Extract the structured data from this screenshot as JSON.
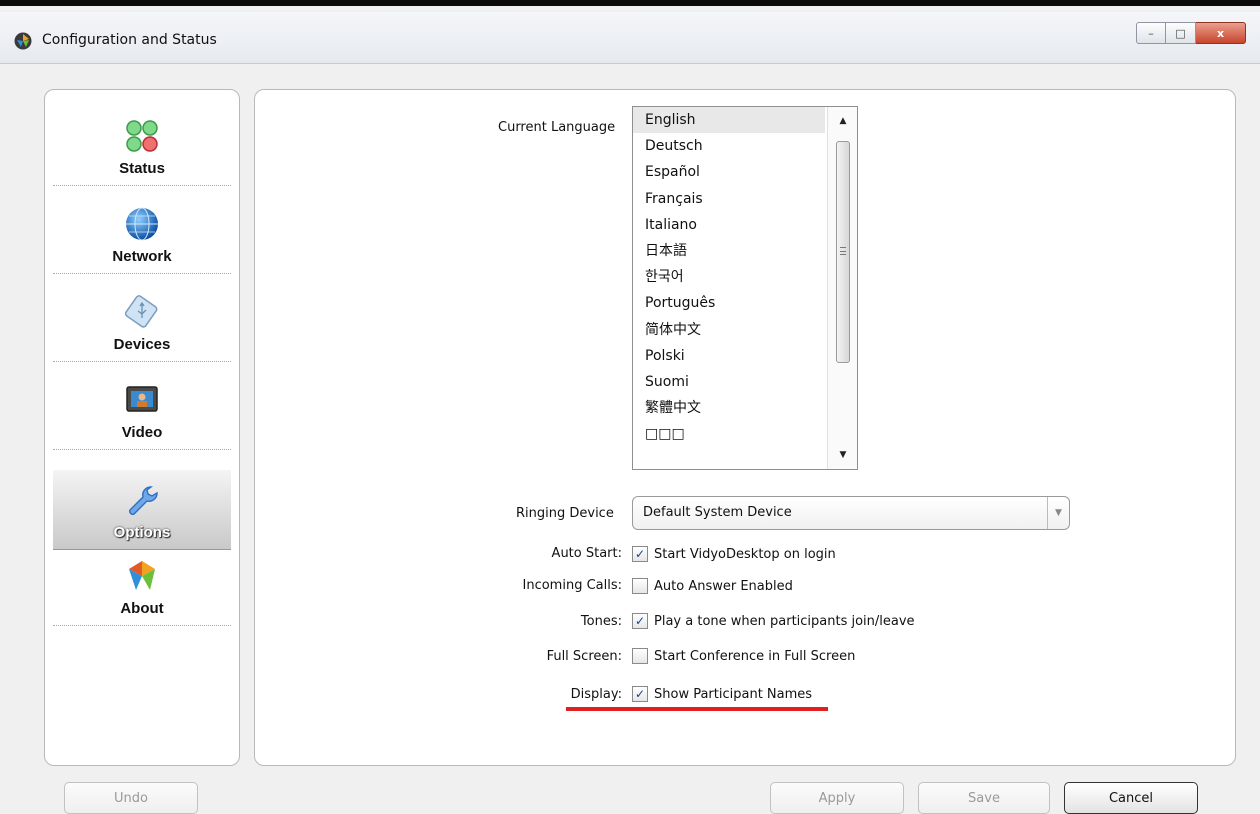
{
  "window": {
    "title": "Configuration and Status",
    "controls": {
      "minimize": "–",
      "maximize": "□",
      "close": "x"
    }
  },
  "sidebar": {
    "items": [
      {
        "label": "Status",
        "icon": "status-lights-icon",
        "selected": false
      },
      {
        "label": "Network",
        "icon": "globe-icon",
        "selected": false
      },
      {
        "label": "Devices",
        "icon": "usb-device-icon",
        "selected": false
      },
      {
        "label": "Video",
        "icon": "monitor-icon",
        "selected": false
      },
      {
        "label": "Options",
        "icon": "wrench-icon",
        "selected": true
      },
      {
        "label": "About",
        "icon": "vidyo-logo-icon",
        "selected": false
      }
    ]
  },
  "options": {
    "language": {
      "label": "Current Language",
      "selected": "English",
      "items": [
        "English",
        "Deutsch",
        "Español",
        "Français",
        "Italiano",
        "日本語",
        "한국어",
        "Português",
        "简体中文",
        "Polski",
        "Suomi",
        "繁體中文",
        "□□□"
      ]
    },
    "ringing_device": {
      "label": "Ringing Device",
      "value": "Default System Device"
    },
    "settings": [
      {
        "label": "Auto Start:",
        "text": "Start VidyoDesktop on login",
        "checked": true
      },
      {
        "label": "Incoming Calls:",
        "text": "Auto Answer Enabled",
        "checked": false
      },
      {
        "label": "Tones:",
        "text": "Play a tone when participants join/leave",
        "checked": true
      },
      {
        "label": "Full Screen:",
        "text": "Start Conference in Full Screen",
        "checked": false
      },
      {
        "label": "Display:",
        "text": "Show Participant Names",
        "checked": true
      }
    ],
    "check_mark": "✓"
  },
  "buttons": {
    "undo": "Undo",
    "apply": "Apply",
    "save": "Save",
    "cancel": "Cancel"
  },
  "colors": {
    "highlight_underline": "#e02020",
    "checkmark": "#1c3e9c"
  }
}
